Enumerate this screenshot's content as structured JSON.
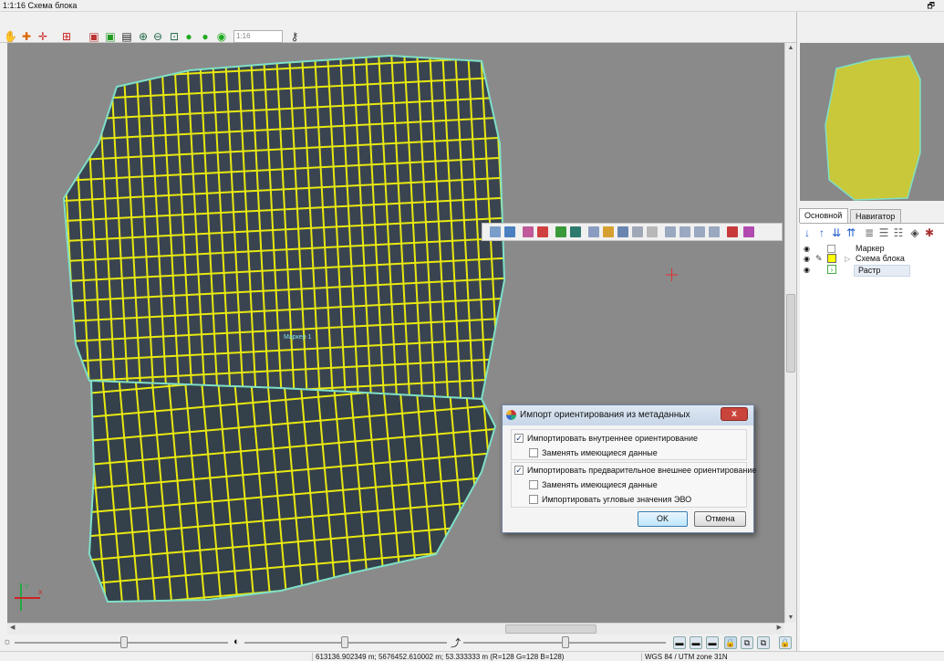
{
  "window": {
    "title": "1:1:16 Схема блока",
    "restore_glyph": "🗗"
  },
  "toolbar": {
    "scale_placeholder": "1:16",
    "icons": [
      "hand-icon",
      "add-point-icon",
      "add-marker-icon",
      "grid-icon",
      "layers-red-icon",
      "layers-green-icon",
      "layers-black-icon",
      "zoom-in-icon",
      "zoom-out-icon",
      "zoom-extent-icon",
      "zoom-fit-icon",
      "zoom-layer-icon",
      "zoom-selection-icon",
      "key-icon"
    ]
  },
  "map": {
    "label": "Маркер 1",
    "axis_y": "Y",
    "axis_x": "X"
  },
  "dialog": {
    "title": "Импорт ориентирования из метаданных",
    "close_label": "x",
    "options": [
      {
        "label": "Импортировать внутреннее ориентирование",
        "checked": true
      },
      {
        "label": "Заменять имеющиеся данные",
        "checked": false
      },
      {
        "label": "Импортировать предварительное внешнее ориентирование",
        "checked": true
      },
      {
        "label": "Заменять имеющиеся данные",
        "checked": false
      },
      {
        "label": "Импортировать угловые значения ЭВО",
        "checked": false
      }
    ],
    "ok_label": "OK",
    "cancel_label": "Отмена"
  },
  "right_panel": {
    "tabs": [
      {
        "label": "Основной",
        "active": true
      },
      {
        "label": "Навигатор",
        "active": false
      }
    ],
    "layers": [
      {
        "name": "Маркер"
      },
      {
        "name": "Схема блока"
      },
      {
        "name": "Растр"
      }
    ]
  },
  "status": {
    "coords": "613136.902349 m; 5676452.610002 m; 53.333333 m (R=128 G=128 B=128)",
    "crs": "WGS 84 / UTM zone 31N"
  },
  "colors": {
    "frame_yellow": "#e8e810",
    "outline_cyan": "#7fe0c8",
    "tile_dark": "#3a4450",
    "background_gray": "#8a8a8a"
  }
}
